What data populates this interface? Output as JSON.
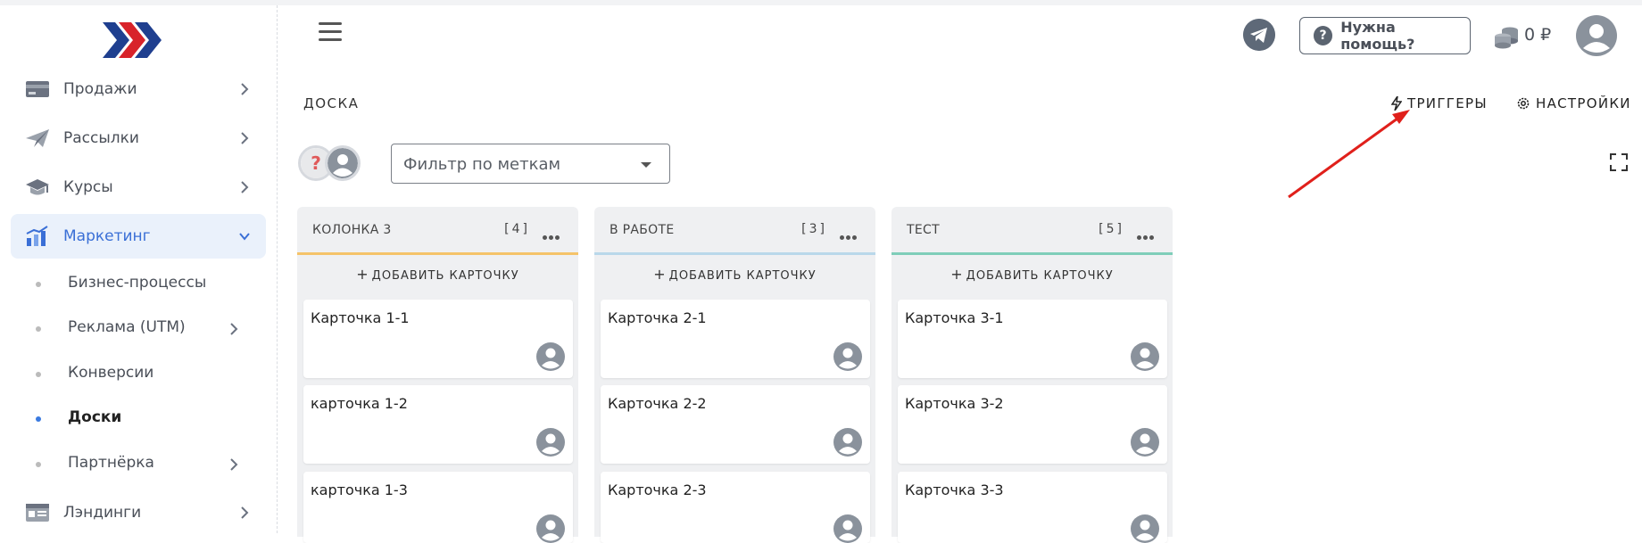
{
  "sidebar": {
    "items": [
      {
        "label": "Продажи",
        "icon": "card-icon"
      },
      {
        "label": "Рассылки",
        "icon": "paper-plane-icon"
      },
      {
        "label": "Курсы",
        "icon": "graduation-cap-icon"
      },
      {
        "label": "Маркетинг",
        "icon": "chart-icon",
        "active": true
      },
      {
        "label": "Лэндинги",
        "icon": "landing-icon"
      }
    ],
    "subitems": [
      {
        "label": "Бизнес-процессы"
      },
      {
        "label": "Реклама (UTM)"
      },
      {
        "label": "Конверсии"
      },
      {
        "label": "Доски",
        "current": true
      },
      {
        "label": "Партнёрка"
      }
    ]
  },
  "header": {
    "help_label": "Нужна помощь?",
    "balance": "0 ₽"
  },
  "board": {
    "title": "ДОСКА",
    "triggers_label": "ТРИГГЕРЫ",
    "settings_label": "НАСТРОЙКИ",
    "filter_placeholder": "Фильтр по меткам",
    "add_card_label": "ДОБАВИТЬ КАРТОЧКУ",
    "columns": [
      {
        "title": "КОЛОНКА 3",
        "count": "[4]",
        "color": "#f5c36a",
        "cards": [
          "Карточка 1-1",
          "карточка 1-2",
          "карточка 1-3"
        ]
      },
      {
        "title": "В РАБОТЕ",
        "count": "[3]",
        "color": "#b9d8ea",
        "cards": [
          "Карточка 2-1",
          "Карточка 2-2",
          "Карточка 2-3"
        ]
      },
      {
        "title": "ТЕСТ",
        "count": "[5]",
        "color": "#7fcdb9",
        "cards": [
          "Карточка 3-1",
          "Карточка 3-2",
          "Карточка 3-3"
        ]
      }
    ]
  },
  "colors": {
    "accent": "#3a6fd6",
    "annotation_arrow": "#e0201b",
    "logo_blue": "#1f3f8f",
    "logo_red": "#d8232a"
  }
}
